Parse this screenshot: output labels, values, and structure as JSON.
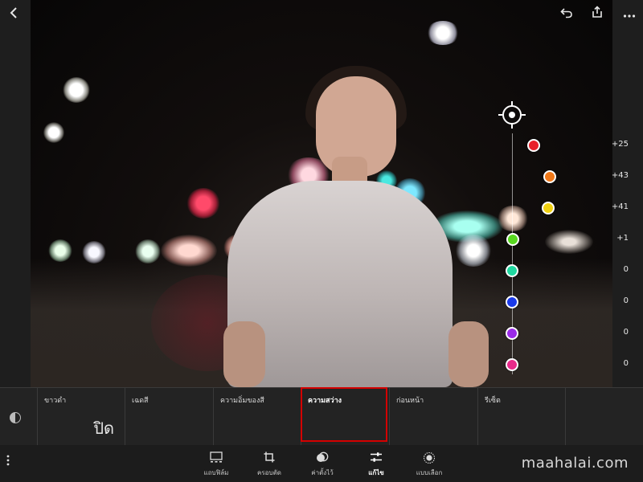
{
  "header": {
    "back_icon": "chevron-left-icon",
    "cloud_icon": "cloud-icon",
    "info_icon": "info-icon",
    "undo_icon": "undo-icon",
    "share_icon": "share-icon",
    "more_icon": "more-horizontal-icon"
  },
  "color_mix": {
    "values": [
      "+25",
      "+43",
      "+41",
      "+1",
      "0",
      "0",
      "0",
      "0"
    ],
    "colors": [
      "#e8202a",
      "#f07818",
      "#f0d010",
      "#58d820",
      "#20d8a0",
      "#1a3ae8",
      "#9a2ae8",
      "#e82a8a"
    ],
    "color_names": [
      "red",
      "orange",
      "yellow",
      "green",
      "aqua",
      "blue",
      "purple",
      "magenta"
    ]
  },
  "panel": {
    "tabs": [
      {
        "label": "ขาวดำ",
        "value": "ปิด"
      },
      {
        "label": "เฉดสี",
        "value": ""
      },
      {
        "label": "ความอิ่มของสี",
        "value": ""
      },
      {
        "label": "ความสว่าง",
        "value": ""
      },
      {
        "label": "ก่อนหน้า",
        "value": ""
      },
      {
        "label": "รีเซ็ต",
        "value": ""
      }
    ],
    "active_tab": "ความสว่าง"
  },
  "toolbar": {
    "items": [
      {
        "label": "แถบฟิล์ม",
        "icon": "filmstrip-icon"
      },
      {
        "label": "ครอบตัด",
        "icon": "crop-icon"
      },
      {
        "label": "ค่าตั้งไว้",
        "icon": "presets-icon"
      },
      {
        "label": "แก้ไข",
        "icon": "sliders-icon"
      },
      {
        "label": "แบบเลือก",
        "icon": "selective-icon"
      }
    ],
    "active": "แก้ไข"
  },
  "watermark": "maahalai.com"
}
